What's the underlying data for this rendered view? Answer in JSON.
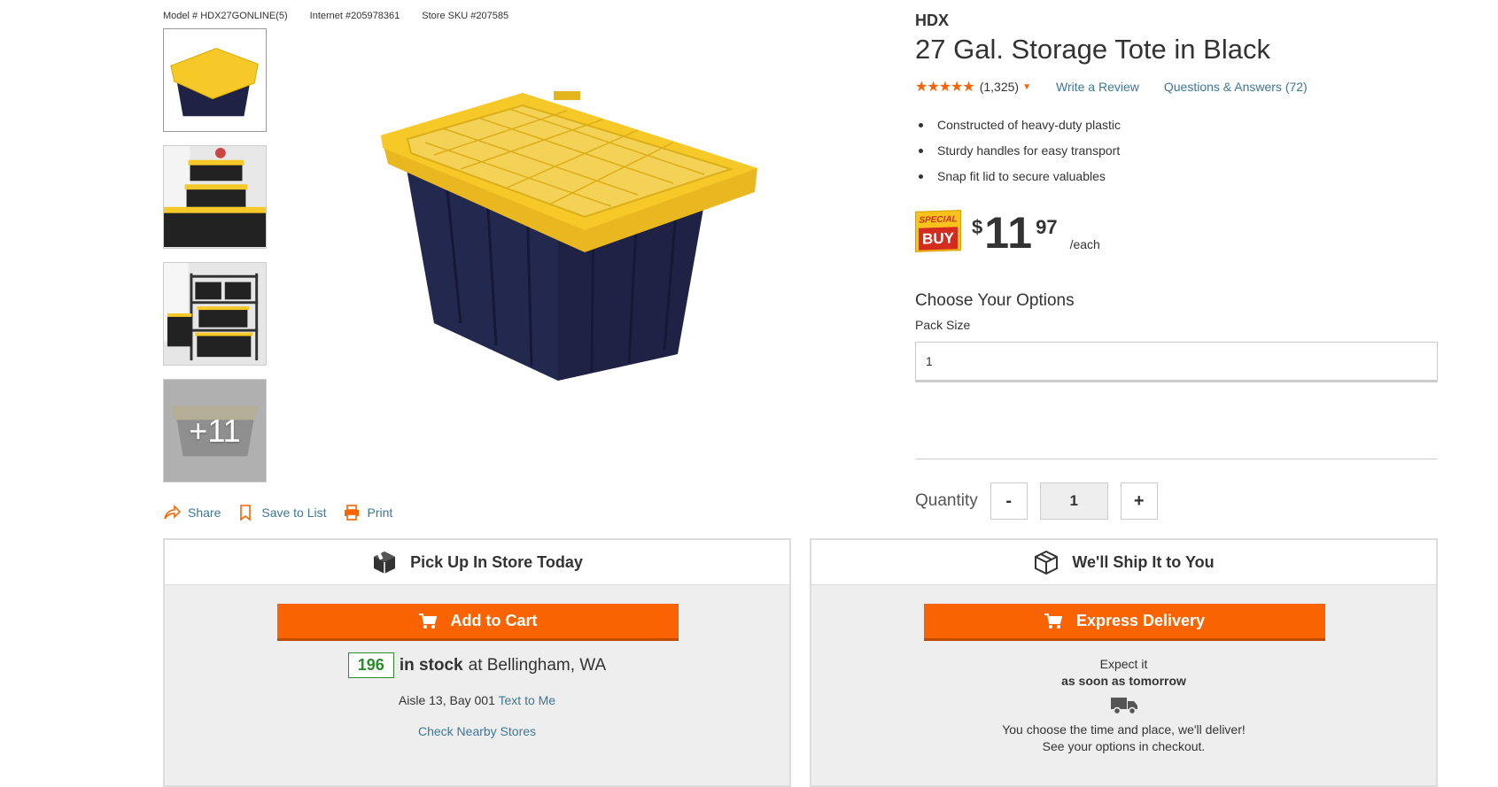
{
  "meta": {
    "model": "Model # HDX27GONLINE(5)",
    "internet": "Internet #205978361",
    "sku": "Store SKU #207585"
  },
  "gallery": {
    "more_count": "+11"
  },
  "actions": {
    "share": "Share",
    "save": "Save to List",
    "print": "Print"
  },
  "product": {
    "brand": "HDX",
    "title": "27 Gal. Storage Tote in Black",
    "stars": "★★★★★",
    "rating": 4.5,
    "review_count": "(1,325)",
    "write_review": "Write a Review",
    "qa": "Questions & Answers (72)",
    "bullets": [
      "Constructed of heavy-duty plastic",
      "Sturdy handles for easy transport",
      "Snap fit lid to secure valuables"
    ]
  },
  "price": {
    "badge_top": "SPECIAL",
    "badge_bottom": "BUY",
    "currency": "$",
    "whole": "11",
    "cents": "97",
    "unit": "/each"
  },
  "options": {
    "title": "Choose Your Options",
    "pack_label": "Pack Size",
    "pack_value": "1"
  },
  "quantity": {
    "label": "Quantity",
    "minus": "-",
    "value": "1",
    "plus": "+"
  },
  "pickup": {
    "title": "Pick Up In Store Today",
    "cta": "Add to Cart",
    "stock_count": "196",
    "stock_label": "in stock",
    "stock_location": "at Bellingham, WA",
    "aisle": "Aisle 13, Bay 001",
    "text_to_me": "Text to Me",
    "nearby": "Check Nearby Stores"
  },
  "ship": {
    "title": "We'll Ship It to You",
    "cta": "Express Delivery",
    "expect": "Expect it",
    "when": "as soon as tomorrow",
    "line1": "You choose the time and place, we'll deliver!",
    "line2": "See your options in checkout."
  },
  "colors": {
    "accent": "#f96302",
    "link": "#3e7697",
    "stock": "#2d8a2d",
    "lid": "#f6c928",
    "tub": "#1f2244"
  }
}
